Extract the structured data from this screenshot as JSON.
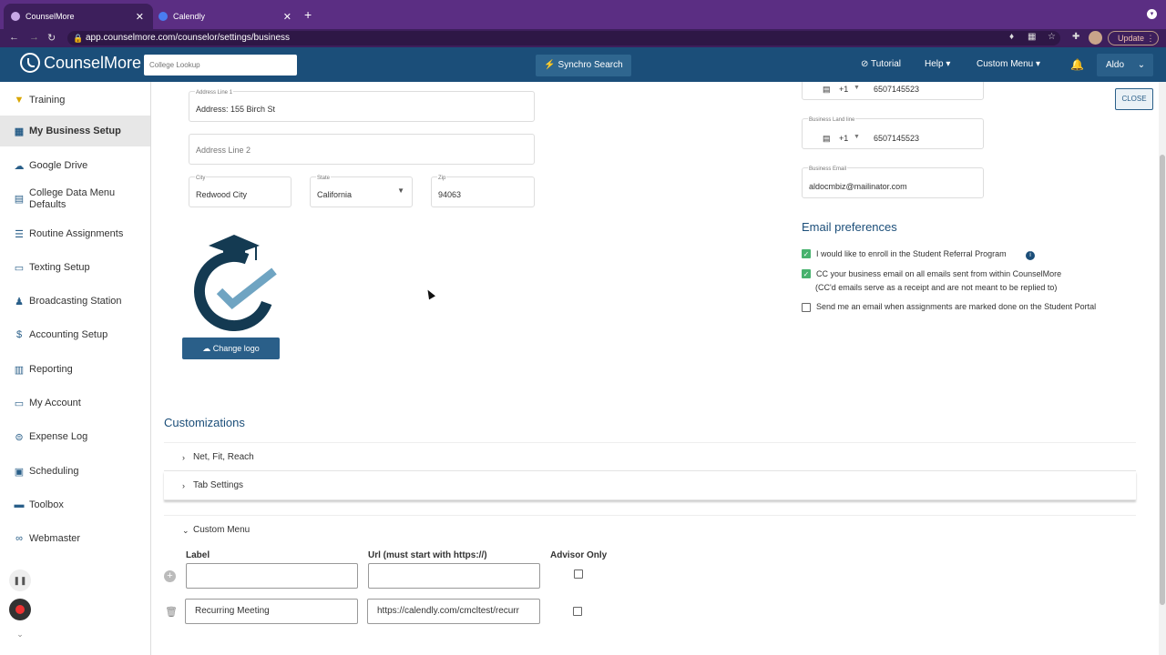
{
  "browser": {
    "tabs": [
      {
        "title": "CounselMore",
        "fav_color": "#c7a8e6"
      },
      {
        "title": "Calendly",
        "fav_color": "#4a7cf0"
      }
    ],
    "new_tab": "+",
    "url": "app.counselmore.com/counselor/settings/business",
    "update_label": "Update"
  },
  "appbar": {
    "logo_text": "CounselMore",
    "search_placeholder": "College Lookup",
    "synchro_label": "Synchro Search",
    "tutorial_label": "Tutorial",
    "help_label": "Help",
    "custom_menu_label": "Custom Menu",
    "user_label": "Aldo"
  },
  "sidebar": {
    "items": [
      {
        "label": "Training",
        "icon": "graduation-cap-icon"
      },
      {
        "label": "My Business Setup",
        "icon": "building-icon"
      },
      {
        "label": "Google Drive",
        "icon": "cloud-check-icon"
      },
      {
        "label": "College Data Menu Defaults",
        "icon": "table-icon"
      },
      {
        "label": "Routine Assignments",
        "icon": "list-icon"
      },
      {
        "label": "Texting Setup",
        "icon": "message-icon"
      },
      {
        "label": "Broadcasting Station",
        "icon": "broadcast-icon"
      },
      {
        "label": "Accounting Setup",
        "icon": "dollar-icon"
      },
      {
        "label": "Reporting",
        "icon": "chart-icon"
      },
      {
        "label": "My Account",
        "icon": "window-icon"
      },
      {
        "label": "Expense Log",
        "icon": "dollar-circle-icon"
      },
      {
        "label": "Scheduling",
        "icon": "calendar-icon"
      },
      {
        "label": "Toolbox",
        "icon": "toolbox-icon"
      },
      {
        "label": "Webmaster",
        "icon": "link-icon"
      }
    ]
  },
  "address": {
    "line1_label": "Address Line 1",
    "line1_value": "Address: 155 Birch St",
    "line2_placeholder": "Address Line 2",
    "city_label": "City",
    "city_value": "Redwood City",
    "state_label": "State",
    "state_value": "California",
    "zip_label": "Zip",
    "zip_value": "94063"
  },
  "contact": {
    "phone_code": "+1",
    "phone_value": "6507145523",
    "landline_label": "Business Land line",
    "landline_code": "+1",
    "landline_value": "6507145523",
    "email_label": "Business Email",
    "email_value": "aldocmbiz@mailinator.com"
  },
  "close_label": "CLOSE",
  "change_logo_label": "Change logo",
  "email_prefs": {
    "title": "Email preferences",
    "option1": "I would like to enroll in the Student Referral Program",
    "option2a": "CC your business email on all emails sent from within CounselMore",
    "option2b": "(CC'd emails serve as a receipt and are not meant to be replied to)",
    "option3": "Send me an email when assignments are marked done on the Student Portal",
    "checked": [
      true,
      true,
      false
    ]
  },
  "customizations": {
    "title": "Customizations",
    "sections": [
      "Net, Fit, Reach",
      "Tab Settings",
      "Custom Menu"
    ],
    "table": {
      "headers": [
        "Label",
        "Url (must start with https://)",
        "Advisor Only"
      ],
      "rows": [
        {
          "label": "",
          "url": "",
          "advisor_only": false
        },
        {
          "label": "Recurring Meeting",
          "url": "https://calendly.com/cmcltest/recurr",
          "advisor_only": false
        }
      ]
    }
  }
}
